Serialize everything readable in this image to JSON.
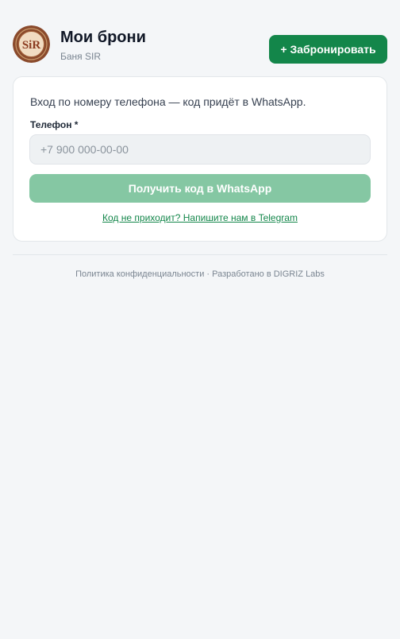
{
  "header": {
    "title": "Мои брони",
    "subtitle": "Баня SIR",
    "logo_icon": "sir-logo-icon",
    "logo_text": "SiR",
    "book_button_label": "+ Забронировать"
  },
  "login": {
    "intro": "Вход по номеру телефона — код придёт в WhatsApp.",
    "phone_label": "Телефон *",
    "phone_placeholder": "+7 900 000-00-00",
    "phone_value": "",
    "submit_label": "Получить код в WhatsApp",
    "telegram_link": "Код не приходит? Напишите нам в Telegram"
  },
  "footer": {
    "text": "Политика конфиденциальности · Разработано в DIGRIZ Labs"
  },
  "colors": {
    "background": "#f4f6f8",
    "accent": "#13864a",
    "accent_disabled": "#85c7a3",
    "input_bg": "#eef1f3"
  }
}
